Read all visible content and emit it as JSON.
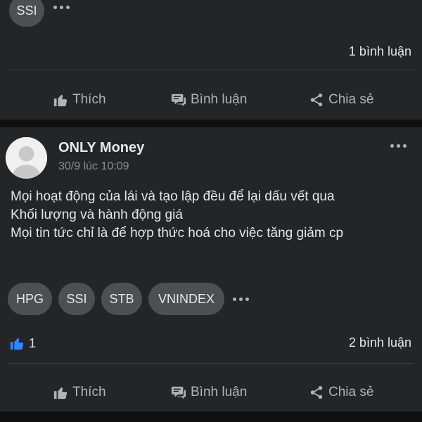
{
  "top_post": {
    "tags": [
      "SSI"
    ],
    "comments": "1 bình luận"
  },
  "actions": {
    "like": "Thích",
    "comment": "Bình luận",
    "share": "Chia sẻ"
  },
  "post": {
    "author": "ONLY Money",
    "timestamp": "30/9 lúc 10:09",
    "lines": [
      "Mọi hoạt động của lái và tạo lập đều để lại dấu vết qua",
      "Khối lượng và hành động giá",
      "Mọi tin tức chỉ là để hợp thức hoá cho việc tăng giảm cp"
    ],
    "tags": [
      "HPG",
      "SSI",
      "STB",
      "VNINDEX"
    ],
    "likes": "1",
    "comments": "2 bình luận"
  },
  "colors": {
    "like_accent": "#2d88ff",
    "card_bg": "#242526",
    "tag_bg": "#4e4f50"
  }
}
